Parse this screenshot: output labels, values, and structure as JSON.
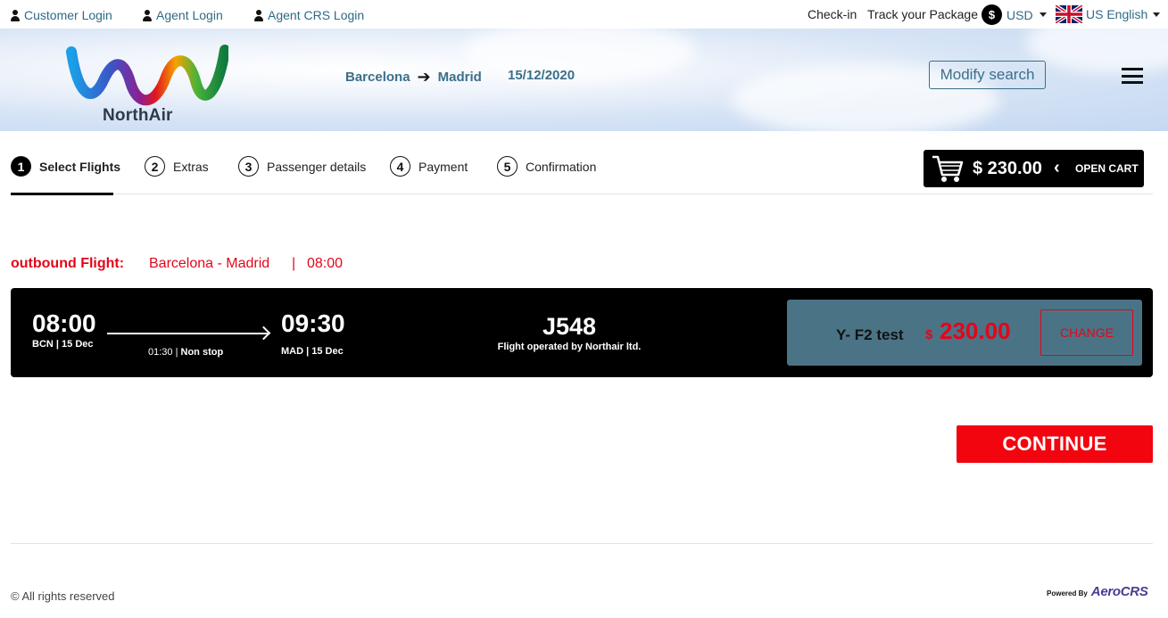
{
  "topbar": {
    "customer_login": "Customer Login",
    "agent_login": "Agent Login",
    "agent_crs_login": "Agent CRS Login",
    "checkin": "Check-in",
    "track_package": "Track your Package",
    "currency_symbol": "$",
    "currency": "USD",
    "language": "US English"
  },
  "header": {
    "brand": "NorthAir",
    "origin": "Barcelona",
    "destination": "Madrid",
    "date": "15/12/2020",
    "modify_label": "Modify search"
  },
  "steps": [
    {
      "num": "1",
      "label": "Select Flights"
    },
    {
      "num": "2",
      "label": "Extras"
    },
    {
      "num": "3",
      "label": "Passenger details"
    },
    {
      "num": "4",
      "label": "Payment"
    },
    {
      "num": "5",
      "label": "Confirmation"
    }
  ],
  "cart": {
    "amount": "$ 230.00",
    "chevron": "‹",
    "label": "OPEN CART"
  },
  "outbound": {
    "label": "outbound Flight:",
    "route": "Barcelona - Madrid",
    "separator": "|",
    "time": "08:00"
  },
  "flight": {
    "dep_time": "08:00",
    "dep_sub": "BCN | 15 Dec",
    "duration": "01:30 |",
    "stops": "Non stop",
    "arr_time": "09:30",
    "arr_sub": "MAD | 15 Dec",
    "number": "J548",
    "operated": "Flight operated by Northair ltd.",
    "fare_class": "Y- F2 test",
    "currency": "$",
    "price": "230.00",
    "change_label": "CHANGE"
  },
  "continue_label": "CONTINUE",
  "footer": {
    "copyright": "© All rights reserved",
    "powered_by": "Powered By",
    "provider": "AeroCRS"
  },
  "colors": {
    "accent_red": "#e2061a",
    "link_blue": "#2f6a86",
    "fare_bg": "#4b7386"
  }
}
